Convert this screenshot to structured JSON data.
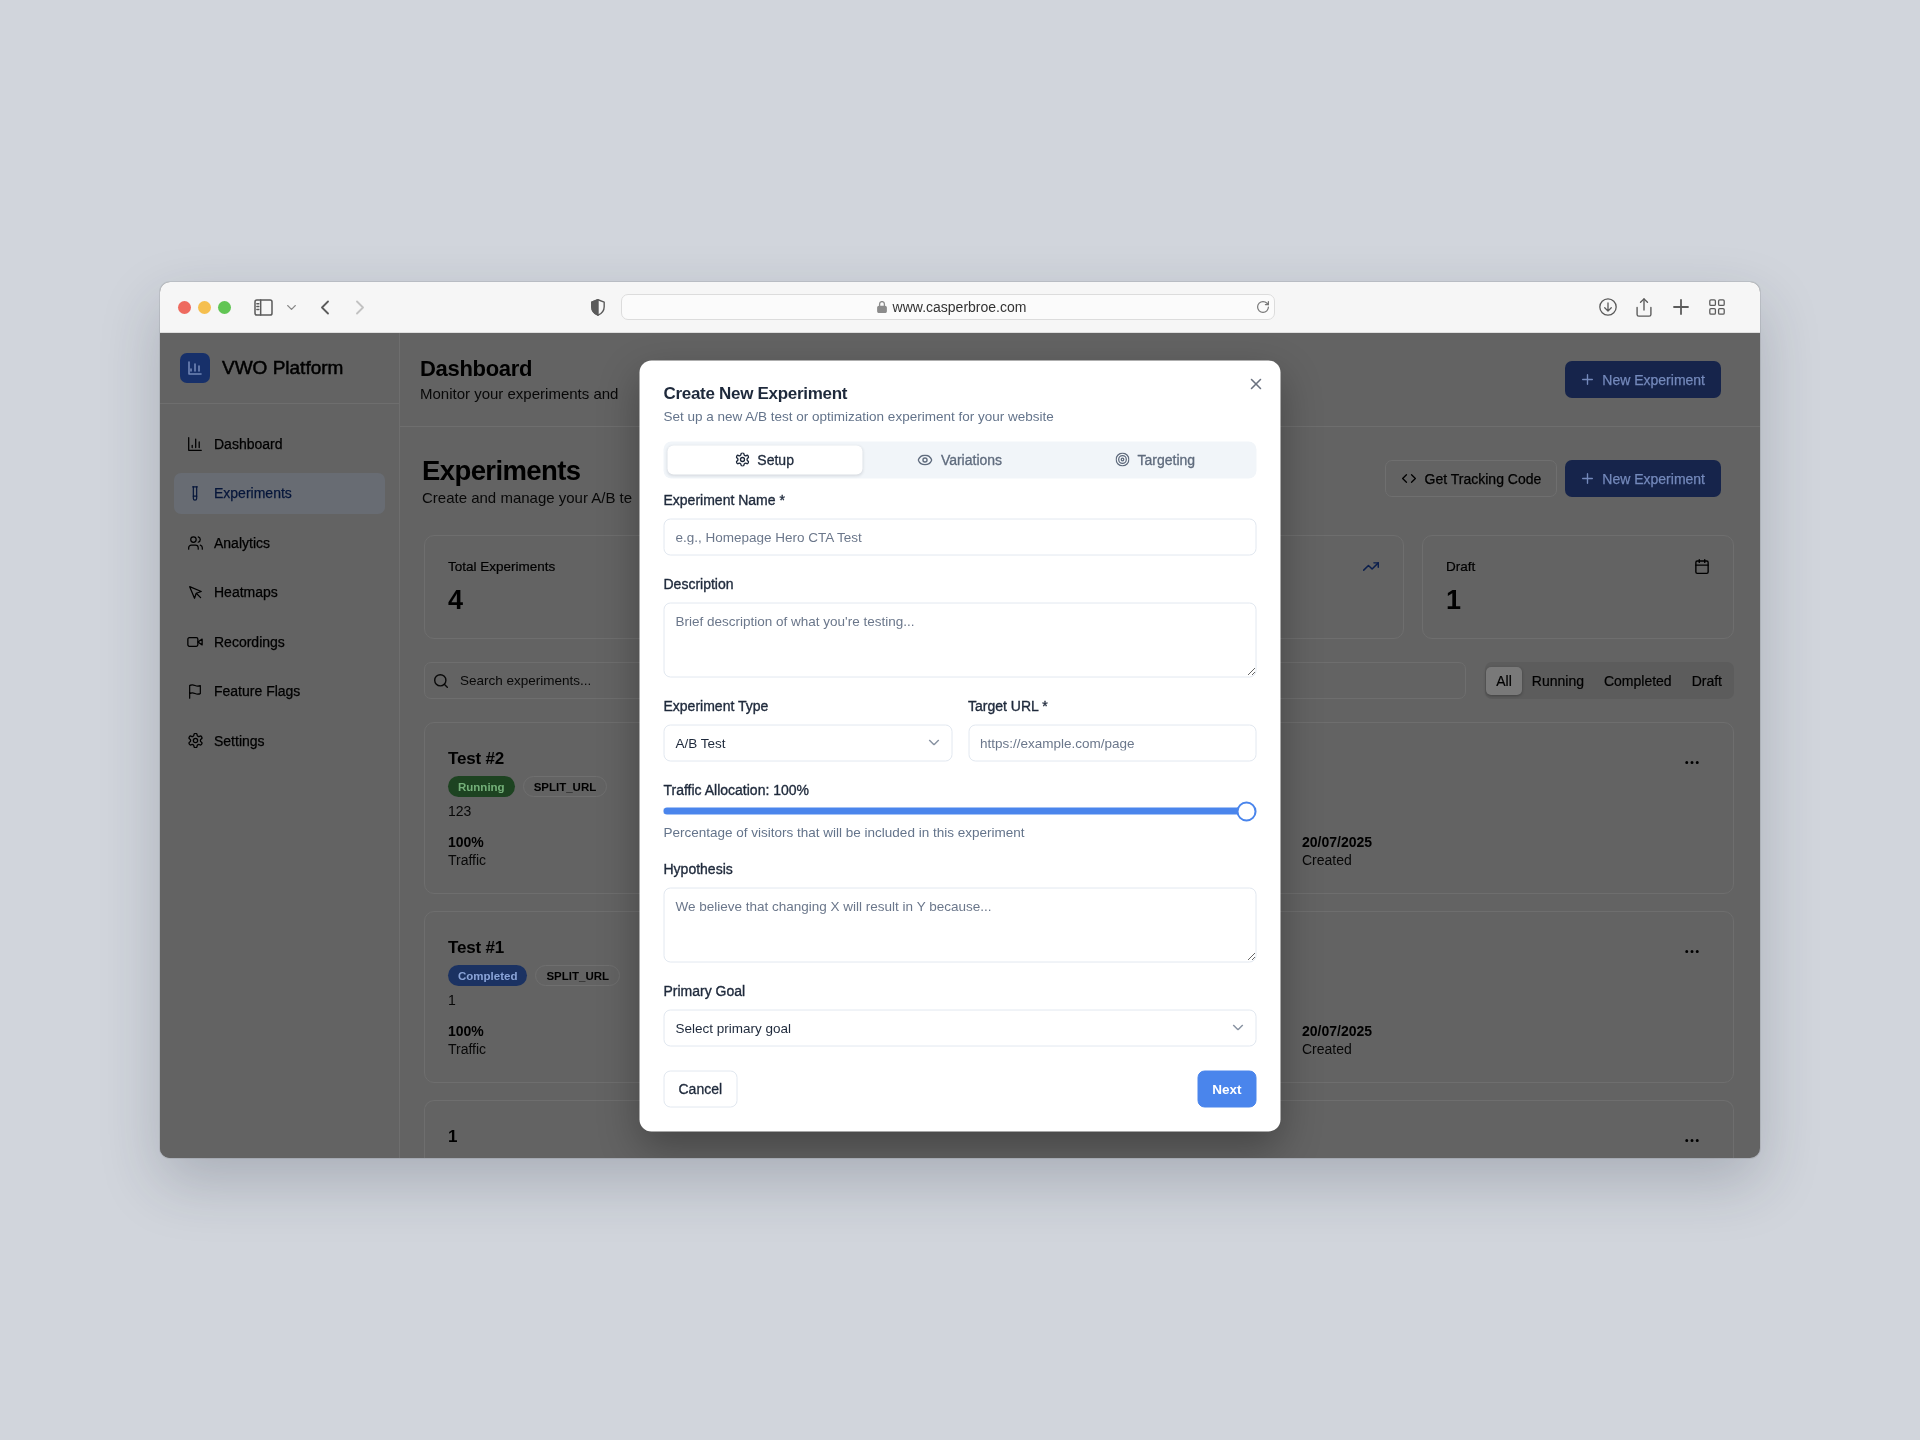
{
  "browser": {
    "url": "www.casperbroe.com"
  },
  "sidebar": {
    "brand": "VWO Platform",
    "items": [
      {
        "label": "Dashboard",
        "selected": false
      },
      {
        "label": "Experiments",
        "selected": true
      },
      {
        "label": "Analytics",
        "selected": false
      },
      {
        "label": "Heatmaps",
        "selected": false
      },
      {
        "label": "Recordings",
        "selected": false
      },
      {
        "label": "Feature Flags",
        "selected": false
      },
      {
        "label": "Settings",
        "selected": false
      }
    ]
  },
  "header": {
    "title": "Dashboard",
    "subtitle": "Monitor your experiments and",
    "button": "New Experiment"
  },
  "page": {
    "title": "Experiments",
    "subtitle": "Create and manage your A/B te",
    "buttons": [
      {
        "label": "Get Tracking Code",
        "kind": "outline"
      },
      {
        "label": "New Experiment",
        "kind": "primary"
      }
    ]
  },
  "stats": [
    {
      "kind": "start",
      "label": "Total Experiments",
      "value": "4"
    },
    {
      "kind": "end"
    },
    {
      "kind": "whole",
      "label": "Draft",
      "value": "1"
    }
  ],
  "search": {
    "placeholder": "Search experiments..."
  },
  "filters": [
    {
      "label": "All",
      "selected": true
    },
    {
      "label": "Running",
      "selected": false
    },
    {
      "label": "Completed",
      "selected": false
    },
    {
      "label": "Draft",
      "selected": false
    }
  ],
  "experiments": [
    {
      "title": "Test #2",
      "status": {
        "label": "Running",
        "kind": "running"
      },
      "type": "SPLIT_URL",
      "description": "123",
      "stats": [
        {
          "value": "100%",
          "label": "Traffic"
        },
        {
          "value": "20/07/2025",
          "label": "Created"
        }
      ]
    },
    {
      "title": "Test #1",
      "status": {
        "label": "Completed",
        "kind": "completed"
      },
      "type": "SPLIT_URL",
      "description": "1",
      "stats": [
        {
          "value": "100%",
          "label": "Traffic"
        },
        {
          "value": "20/07/2025",
          "label": "Created"
        }
      ]
    },
    {
      "title": "1"
    }
  ],
  "dialog": {
    "title": "Create New Experiment",
    "subtitle": "Set up a new A/B test or optimization experiment for your website",
    "tabs": [
      {
        "label": "Setup",
        "selected": true
      },
      {
        "label": "Variations",
        "selected": false
      },
      {
        "label": "Targeting",
        "selected": false
      }
    ],
    "rows": [
      {
        "fields": [
          {
            "kind": "input",
            "label": "Experiment Name *",
            "placeholder": "e.g., Homepage Hero CTA Test"
          }
        ]
      },
      {
        "fields": [
          {
            "kind": "textarea",
            "label": "Description",
            "placeholder": "Brief description of what you're testing..."
          }
        ]
      },
      {
        "fields": [
          {
            "kind": "select",
            "label": "Experiment Type",
            "value": "A/B Test"
          },
          {
            "kind": "input",
            "label": "Target URL *",
            "placeholder": "https://example.com/page"
          }
        ]
      },
      {
        "fields": [
          {
            "kind": "slider",
            "label": "Traffic Allocation: 100%",
            "level": 1,
            "hint": "Percentage of visitors that will be included in this experiment"
          }
        ]
      },
      {
        "fields": [
          {
            "kind": "textarea",
            "label": "Hypothesis",
            "placeholder": "We believe that changing X will result in Y because..."
          }
        ]
      },
      {
        "fields": [
          {
            "kind": "select",
            "label": "Primary Goal",
            "placeholder": "Select primary goal"
          }
        ]
      }
    ],
    "buttons": [
      {
        "label": "Cancel",
        "kind": "outline"
      },
      {
        "label": "Next",
        "kind": "primary"
      }
    ]
  }
}
